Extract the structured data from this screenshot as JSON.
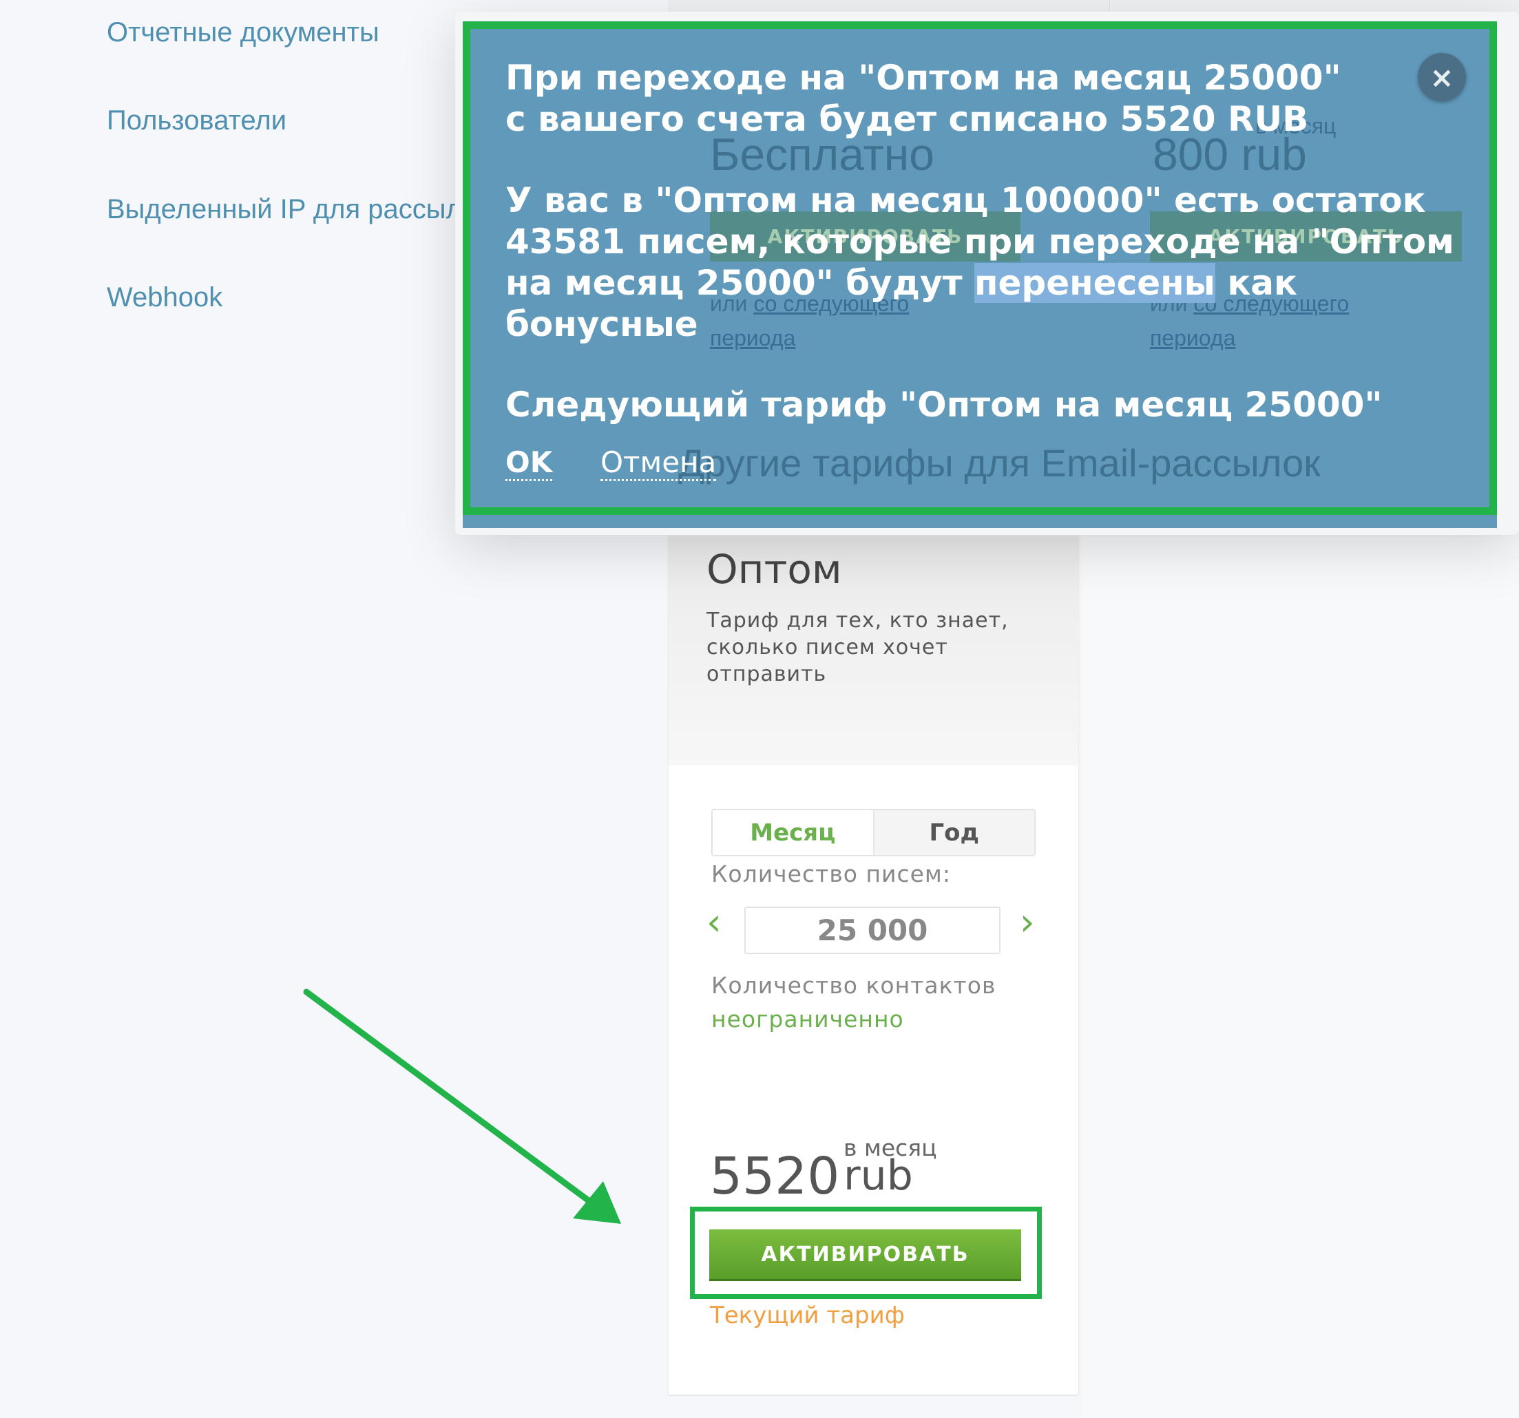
{
  "sidebar": {
    "items": [
      {
        "label": "Отчетные документы"
      },
      {
        "label": "Пользователи"
      },
      {
        "label": "Выделенный IP для рассылок"
      },
      {
        "label": "Webhook"
      }
    ]
  },
  "background": {
    "free_price": "Бесплатно",
    "per_month": "в месяц",
    "price_800": "800 rub",
    "activate": "АКТИВИРОВАТЬ",
    "or": "или",
    "next_period_1": "со следующего",
    "next_period_2": "периода",
    "other_tariffs": "Другие тарифы для Email-рассылок"
  },
  "dialog": {
    "line1": "При переходе на \"Оптом на месяц 25000\" с вашего счета будет списано 5520 RUB",
    "line2_pre": "У вас в \"Оптом на месяц 100000\" есть остаток 43581 писем, которые при переходе на \"Оптом на месяц 25000\" будут ",
    "line2_hl": "перенесены",
    "line2_post": " как бонусные",
    "line3": "Следующий тариф \"Оптом на месяц 25000\"",
    "ok": "OK",
    "cancel": "Отмена",
    "close_icon": "×",
    "frame_color": "#22b34a"
  },
  "card": {
    "title": "Оптом",
    "description": "Тариф для тех, кто знает, сколько писем хочет отправить",
    "tabs": [
      {
        "label": "Месяц",
        "active": true
      },
      {
        "label": "Год",
        "active": false
      }
    ],
    "letters_label": "Количество писем:",
    "letters_value": "25 000",
    "prev_icon": "‹",
    "next_icon": "›",
    "contacts_label": "Количество контактов",
    "contacts_value": "неограниченно",
    "price": "5520",
    "per_month": "в месяц",
    "currency": "rub",
    "activate": "АКТИВИРОВАТЬ",
    "current": "Текущий тариф",
    "accent": "#6ab04c",
    "current_color": "#f0a040"
  },
  "annotation": {
    "arrow_color": "#22b34a"
  }
}
